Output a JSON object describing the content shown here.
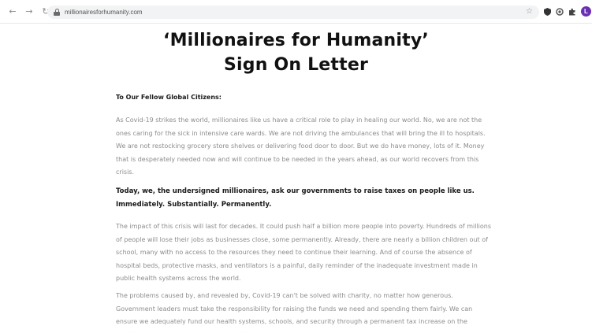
{
  "browser": {
    "url": "millionairesforhumanity.com",
    "back_glyph": "←",
    "forward_glyph": "→",
    "reload_glyph": "↻",
    "star_glyph": "☆",
    "avatar_initial": "L",
    "avatar_color": "#6b2fb3",
    "extensions": [
      "shield-icon",
      "circle-icon",
      "puzzle-icon"
    ]
  },
  "page": {
    "title_line1": "‘Millionaires for Humanity’",
    "title_line2": "Sign On Letter",
    "greeting": "To Our Fellow Global Citizens:",
    "paragraph1": "As Covid-19 strikes the world, millionaires like us have a critical role to play in healing our world. No, we are not the ones caring for the sick in intensive care wards. We are not driving the ambulances that will bring the ill to hospitals. We are not restocking grocery store shelves or delivering food door to door. But we do have money, lots of it. Money that is desperately needed now and will continue to be needed in the years ahead, as our world recovers from this crisis.",
    "bold_statement": "Today, we, the undersigned millionaires, ask our governments to raise taxes on people like us. Immediately. Substantially. Permanently.",
    "paragraph3": "The impact of this crisis will last for decades. It could push half a billion more people into poverty. Hundreds of millions of people will lose their jobs as businesses close, some permanently. Already, there are nearly a billion children out of school, many with no access to the resources they need to continue their learning. And of course the absence of hospital beds, protective masks, and ventilators is a painful, daily reminder of the inadequate investment made in public health systems across the world.",
    "paragraph4": "The problems caused by, and revealed by, Covid-19 can't be solved with charity, no matter how generous. Government leaders must take the responsibility for raising the funds we need and spending them fairly. We can ensure we adequately fund our health systems, schools, and security through a permanent tax increase on the wealthiest people on the planet, people like us."
  }
}
